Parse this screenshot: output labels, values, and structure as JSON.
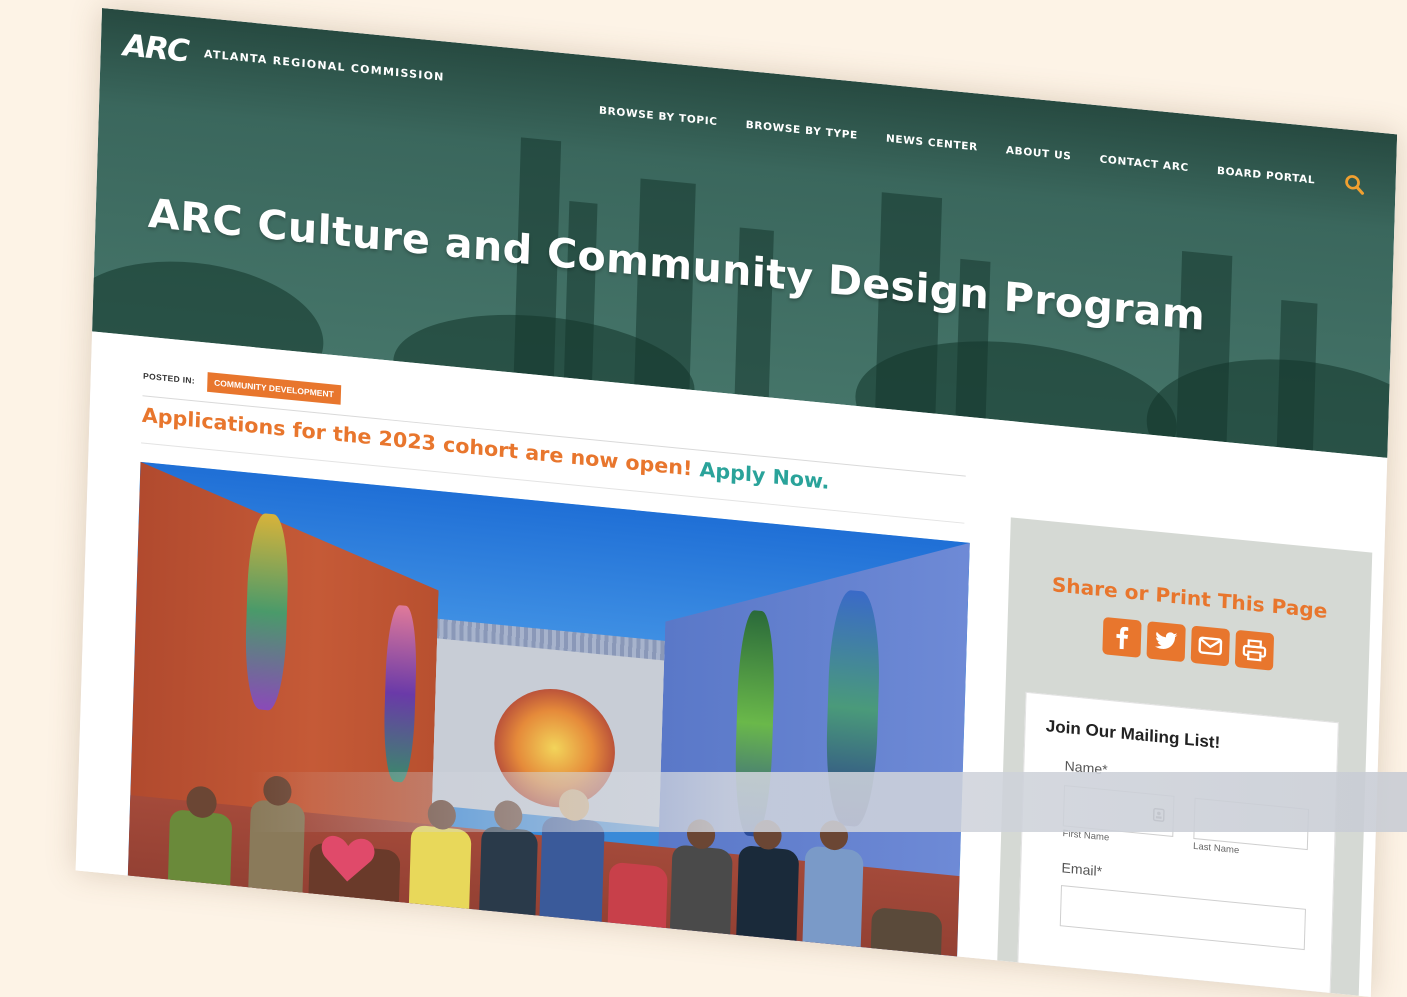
{
  "site": {
    "logo_mark": "ARC",
    "logo_text": "ATLANTA REGIONAL COMMISSION"
  },
  "nav": {
    "items": [
      {
        "label": "BROWSE BY TOPIC"
      },
      {
        "label": "BROWSE BY TYPE"
      },
      {
        "label": "NEWS CENTER"
      },
      {
        "label": "ABOUT US"
      },
      {
        "label": "CONTACT ARC"
      },
      {
        "label": "BOARD PORTAL"
      }
    ],
    "search_icon": "search-icon"
  },
  "page": {
    "title": "ARC Culture and Community Design Program",
    "posted_label": "POSTED IN:",
    "category": "COMMUNITY DEVELOPMENT",
    "announcement": "Applications for the 2023 cohort are now open!",
    "apply_link": "Apply Now."
  },
  "share": {
    "title": "Share or Print This Page",
    "icons": [
      "facebook-icon",
      "twitter-icon",
      "email-icon",
      "print-icon"
    ]
  },
  "mailing": {
    "title": "Join Our Mailing List!",
    "name_label": "Name*",
    "first_name_sub": "First Name",
    "last_name_sub": "Last Name",
    "email_label": "Email*"
  },
  "colors": {
    "accent_orange": "#e8762d",
    "header_green": "#1f5a4a",
    "link_teal": "#2aa39a"
  }
}
